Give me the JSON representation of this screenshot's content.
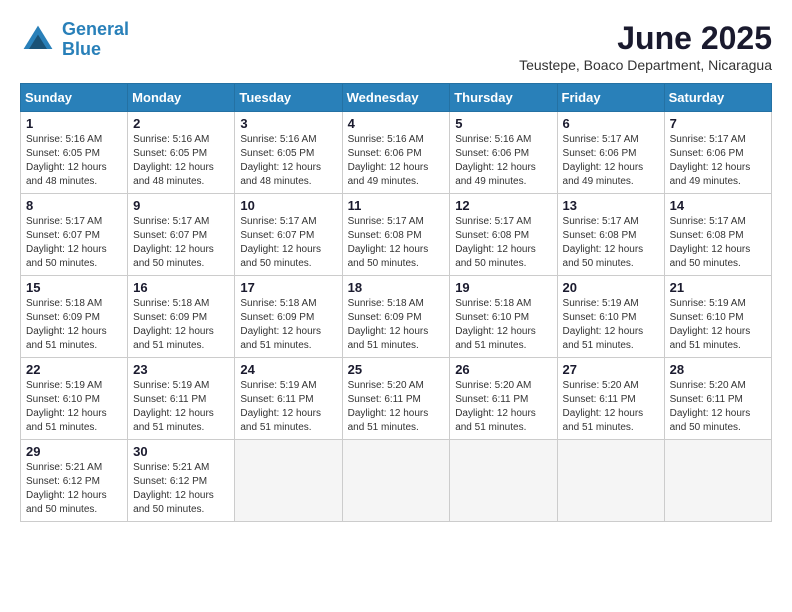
{
  "header": {
    "logo_line1": "General",
    "logo_line2": "Blue",
    "month_title": "June 2025",
    "location": "Teustepe, Boaco Department, Nicaragua"
  },
  "weekdays": [
    "Sunday",
    "Monday",
    "Tuesday",
    "Wednesday",
    "Thursday",
    "Friday",
    "Saturday"
  ],
  "weeks": [
    [
      {
        "day": "1",
        "sunrise": "5:16 AM",
        "sunset": "6:05 PM",
        "daylight": "12 hours and 48 minutes."
      },
      {
        "day": "2",
        "sunrise": "5:16 AM",
        "sunset": "6:05 PM",
        "daylight": "12 hours and 48 minutes."
      },
      {
        "day": "3",
        "sunrise": "5:16 AM",
        "sunset": "6:05 PM",
        "daylight": "12 hours and 48 minutes."
      },
      {
        "day": "4",
        "sunrise": "5:16 AM",
        "sunset": "6:06 PM",
        "daylight": "12 hours and 49 minutes."
      },
      {
        "day": "5",
        "sunrise": "5:16 AM",
        "sunset": "6:06 PM",
        "daylight": "12 hours and 49 minutes."
      },
      {
        "day": "6",
        "sunrise": "5:17 AM",
        "sunset": "6:06 PM",
        "daylight": "12 hours and 49 minutes."
      },
      {
        "day": "7",
        "sunrise": "5:17 AM",
        "sunset": "6:06 PM",
        "daylight": "12 hours and 49 minutes."
      }
    ],
    [
      {
        "day": "8",
        "sunrise": "5:17 AM",
        "sunset": "6:07 PM",
        "daylight": "12 hours and 50 minutes."
      },
      {
        "day": "9",
        "sunrise": "5:17 AM",
        "sunset": "6:07 PM",
        "daylight": "12 hours and 50 minutes."
      },
      {
        "day": "10",
        "sunrise": "5:17 AM",
        "sunset": "6:07 PM",
        "daylight": "12 hours and 50 minutes."
      },
      {
        "day": "11",
        "sunrise": "5:17 AM",
        "sunset": "6:08 PM",
        "daylight": "12 hours and 50 minutes."
      },
      {
        "day": "12",
        "sunrise": "5:17 AM",
        "sunset": "6:08 PM",
        "daylight": "12 hours and 50 minutes."
      },
      {
        "day": "13",
        "sunrise": "5:17 AM",
        "sunset": "6:08 PM",
        "daylight": "12 hours and 50 minutes."
      },
      {
        "day": "14",
        "sunrise": "5:17 AM",
        "sunset": "6:08 PM",
        "daylight": "12 hours and 50 minutes."
      }
    ],
    [
      {
        "day": "15",
        "sunrise": "5:18 AM",
        "sunset": "6:09 PM",
        "daylight": "12 hours and 51 minutes."
      },
      {
        "day": "16",
        "sunrise": "5:18 AM",
        "sunset": "6:09 PM",
        "daylight": "12 hours and 51 minutes."
      },
      {
        "day": "17",
        "sunrise": "5:18 AM",
        "sunset": "6:09 PM",
        "daylight": "12 hours and 51 minutes."
      },
      {
        "day": "18",
        "sunrise": "5:18 AM",
        "sunset": "6:09 PM",
        "daylight": "12 hours and 51 minutes."
      },
      {
        "day": "19",
        "sunrise": "5:18 AM",
        "sunset": "6:10 PM",
        "daylight": "12 hours and 51 minutes."
      },
      {
        "day": "20",
        "sunrise": "5:19 AM",
        "sunset": "6:10 PM",
        "daylight": "12 hours and 51 minutes."
      },
      {
        "day": "21",
        "sunrise": "5:19 AM",
        "sunset": "6:10 PM",
        "daylight": "12 hours and 51 minutes."
      }
    ],
    [
      {
        "day": "22",
        "sunrise": "5:19 AM",
        "sunset": "6:10 PM",
        "daylight": "12 hours and 51 minutes."
      },
      {
        "day": "23",
        "sunrise": "5:19 AM",
        "sunset": "6:11 PM",
        "daylight": "12 hours and 51 minutes."
      },
      {
        "day": "24",
        "sunrise": "5:19 AM",
        "sunset": "6:11 PM",
        "daylight": "12 hours and 51 minutes."
      },
      {
        "day": "25",
        "sunrise": "5:20 AM",
        "sunset": "6:11 PM",
        "daylight": "12 hours and 51 minutes."
      },
      {
        "day": "26",
        "sunrise": "5:20 AM",
        "sunset": "6:11 PM",
        "daylight": "12 hours and 51 minutes."
      },
      {
        "day": "27",
        "sunrise": "5:20 AM",
        "sunset": "6:11 PM",
        "daylight": "12 hours and 51 minutes."
      },
      {
        "day": "28",
        "sunrise": "5:20 AM",
        "sunset": "6:11 PM",
        "daylight": "12 hours and 50 minutes."
      }
    ],
    [
      {
        "day": "29",
        "sunrise": "5:21 AM",
        "sunset": "6:12 PM",
        "daylight": "12 hours and 50 minutes."
      },
      {
        "day": "30",
        "sunrise": "5:21 AM",
        "sunset": "6:12 PM",
        "daylight": "12 hours and 50 minutes."
      },
      null,
      null,
      null,
      null,
      null
    ]
  ]
}
